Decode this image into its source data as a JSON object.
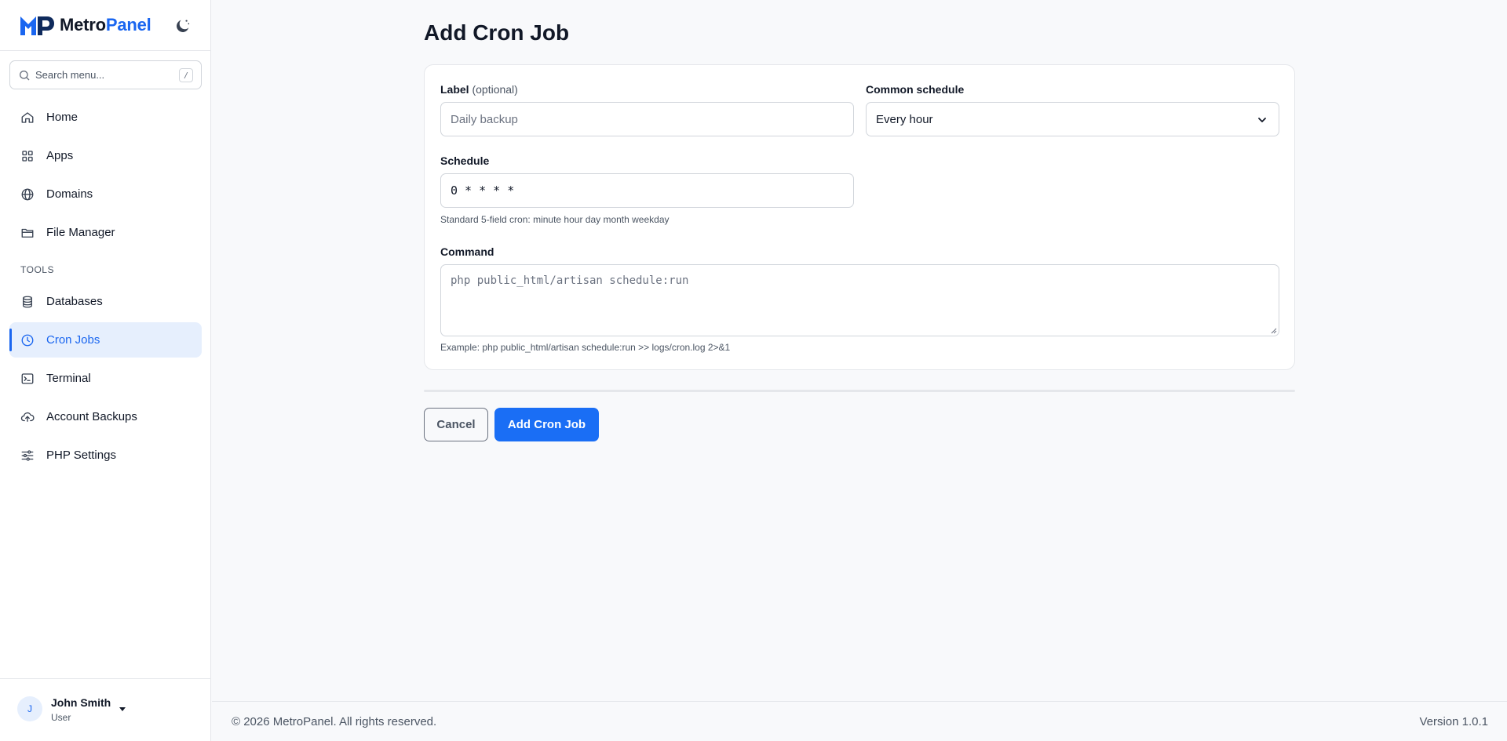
{
  "app": {
    "brand_part1": "Metro",
    "brand_part2": "Panel",
    "brand_color": "#1a66f0"
  },
  "sidebar": {
    "search": {
      "placeholder": "Search menu...",
      "shortcut": "/"
    },
    "items": [
      {
        "label": "Home",
        "icon": "home-icon"
      },
      {
        "label": "Apps",
        "icon": "apps-grid-icon"
      },
      {
        "label": "Domains",
        "icon": "globe-icon"
      },
      {
        "label": "File Manager",
        "icon": "folder-icon"
      }
    ],
    "section_title": "TOOLS",
    "tools": [
      {
        "label": "Databases",
        "icon": "database-icon"
      },
      {
        "label": "Cron Jobs",
        "icon": "clock-icon",
        "active": true
      },
      {
        "label": "Terminal",
        "icon": "terminal-icon"
      },
      {
        "label": "Account Backups",
        "icon": "cloud-upload-icon"
      },
      {
        "label": "PHP Settings",
        "icon": "sliders-icon"
      }
    ],
    "user": {
      "initial": "J",
      "name": "John Smith",
      "role": "User"
    }
  },
  "main": {
    "title": "Add Cron Job",
    "form": {
      "label_field": {
        "label": "Label",
        "optional": "(optional)",
        "placeholder": "Daily backup",
        "value": ""
      },
      "common_schedule": {
        "label": "Common schedule",
        "selected": "Every hour"
      },
      "schedule": {
        "label": "Schedule",
        "value": "0 * * * *",
        "hint": "Standard 5-field cron: minute hour day month weekday"
      },
      "command": {
        "label": "Command",
        "placeholder": "php public_html/artisan schedule:run",
        "hint": "Example: php public_html/artisan schedule:run >> logs/cron.log 2>&1"
      }
    },
    "actions": {
      "cancel": "Cancel",
      "submit": "Add Cron Job"
    }
  },
  "footer": {
    "copyright": "© 2026 MetroPanel. All rights reserved.",
    "version": "Version 1.0.1"
  }
}
